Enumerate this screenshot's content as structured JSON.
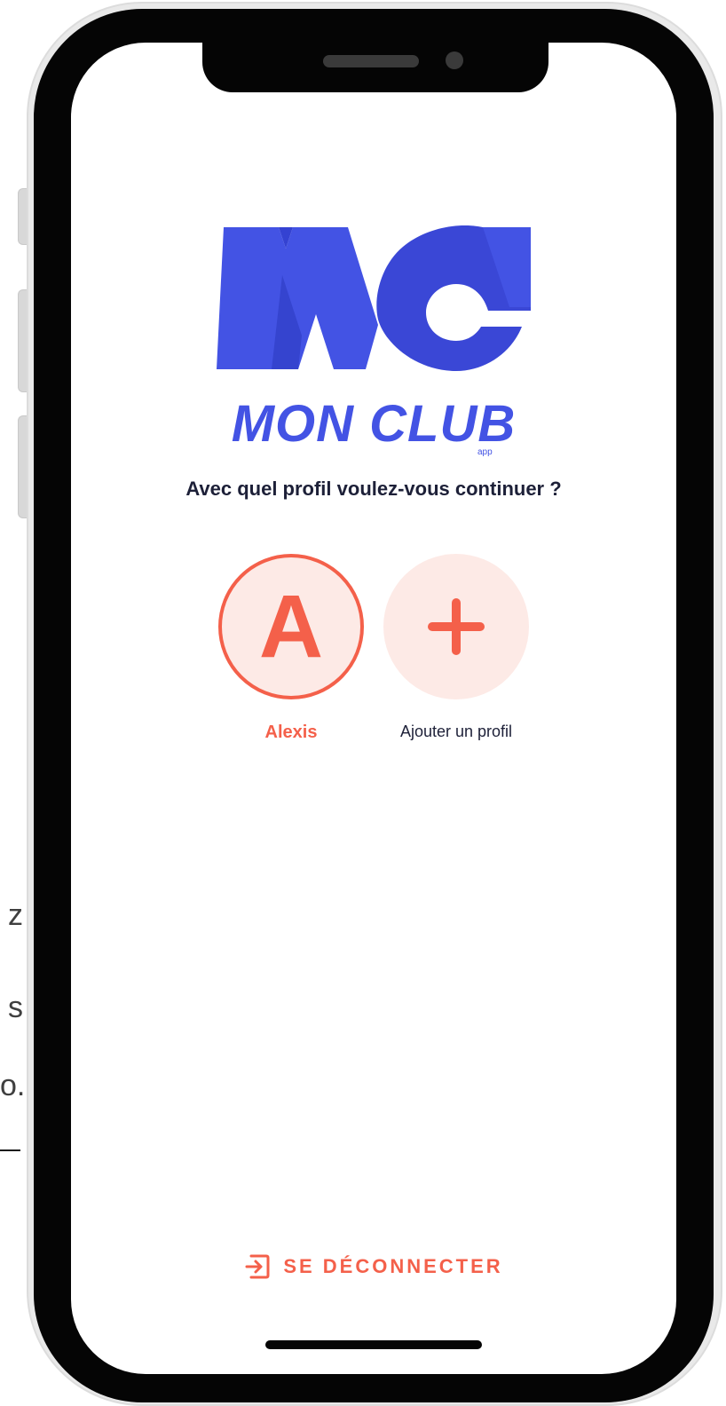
{
  "background": {
    "fragments": [
      "z",
      "s",
      "o."
    ]
  },
  "app": {
    "brand_name": "MON CLUB",
    "brand_sub": "app",
    "logo_letters": "MC"
  },
  "profile_select": {
    "question": "Avec quel profil voulez-vous continuer ?",
    "profiles": [
      {
        "initial": "A",
        "name": "Alexis",
        "selected": true
      }
    ],
    "add_profile": {
      "label": "Ajouter un profil",
      "icon": "plus-icon"
    }
  },
  "footer": {
    "logout_label": "SE DÉCONNECTER",
    "logout_icon": "logout-icon"
  },
  "colors": {
    "brand_blue": "#4353e4",
    "brand_blue_dark": "#2f3ec7",
    "accent_coral": "#f4604a",
    "avatar_bg": "#fdeae6",
    "text_dark": "#1d2038"
  }
}
